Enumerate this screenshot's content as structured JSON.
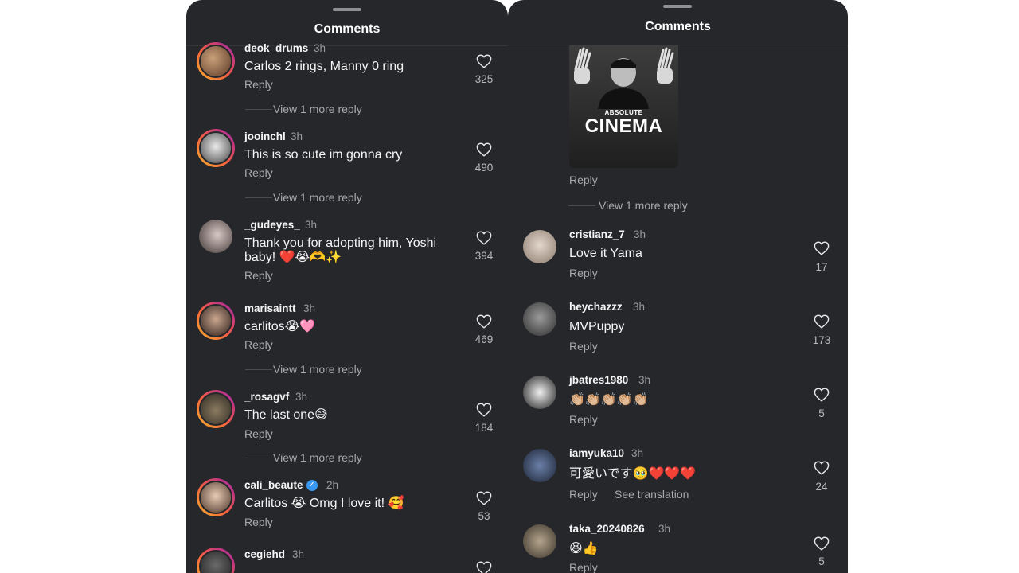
{
  "left": {
    "title": "Comments",
    "comments": [
      {
        "username": "deok_drums",
        "time": "3h",
        "text": "Carlos 2 rings, Manny 0 ring",
        "reply": "Reply",
        "likes": "325",
        "view_more": "View 1 more reply"
      },
      {
        "username": "jooinchl",
        "time": "3h",
        "text": "This is so cute im gonna cry",
        "reply": "Reply",
        "likes": "490",
        "view_more": "View 1 more reply"
      },
      {
        "username": "_gudeyes_",
        "time": "3h",
        "text": "Thank you for adopting him, Yoshi baby! ❤️😭🫶✨",
        "reply": "Reply",
        "likes": "394"
      },
      {
        "username": "marisaintt",
        "time": "3h",
        "text": "carlitos😭🩷",
        "reply": "Reply",
        "likes": "469",
        "view_more": "View 1 more reply"
      },
      {
        "username": "_rosagvf",
        "time": "3h",
        "text": "The last one😅",
        "reply": "Reply",
        "likes": "184",
        "view_more": "View 1 more reply"
      },
      {
        "username": "cali_beaute",
        "time": "2h",
        "text": "Carlitos 😭 Omg I love it! 🥰",
        "reply": "Reply",
        "likes": "53"
      },
      {
        "username": "cegiehd",
        "time": "3h"
      }
    ]
  },
  "right": {
    "title": "Comments",
    "media": {
      "subtitle": "ABSOLUTE",
      "title": "CINEMA"
    },
    "media_reply": "Reply",
    "media_view_more": "View 1 more reply",
    "comments": [
      {
        "username": "cristianz_7",
        "time": "3h",
        "text": "Love it Yama",
        "reply": "Reply",
        "likes": "17"
      },
      {
        "username": "heychazzz",
        "time": "3h",
        "text": "MVPuppy",
        "reply": "Reply",
        "likes": "173"
      },
      {
        "username": "jbatres1980",
        "time": "3h",
        "text": "👏🏼👏🏼👏🏼👏🏼👏🏼",
        "reply": "Reply",
        "likes": "5"
      },
      {
        "username": "iamyuka10",
        "time": "3h",
        "text": "可愛いです🥹❤️❤️❤️",
        "reply": "Reply",
        "see_translation": "See translation",
        "likes": "24"
      },
      {
        "username": "taka_20240826",
        "time": "3h",
        "text": "😆👍",
        "reply": "Reply",
        "likes": "5"
      }
    ]
  },
  "colors": {
    "panel_bg": "#26272b",
    "story_ring": "#f56040",
    "verified": "#3897f0"
  },
  "icons": [
    "heart-icon",
    "verified-badge-icon",
    "drag-handle"
  ]
}
